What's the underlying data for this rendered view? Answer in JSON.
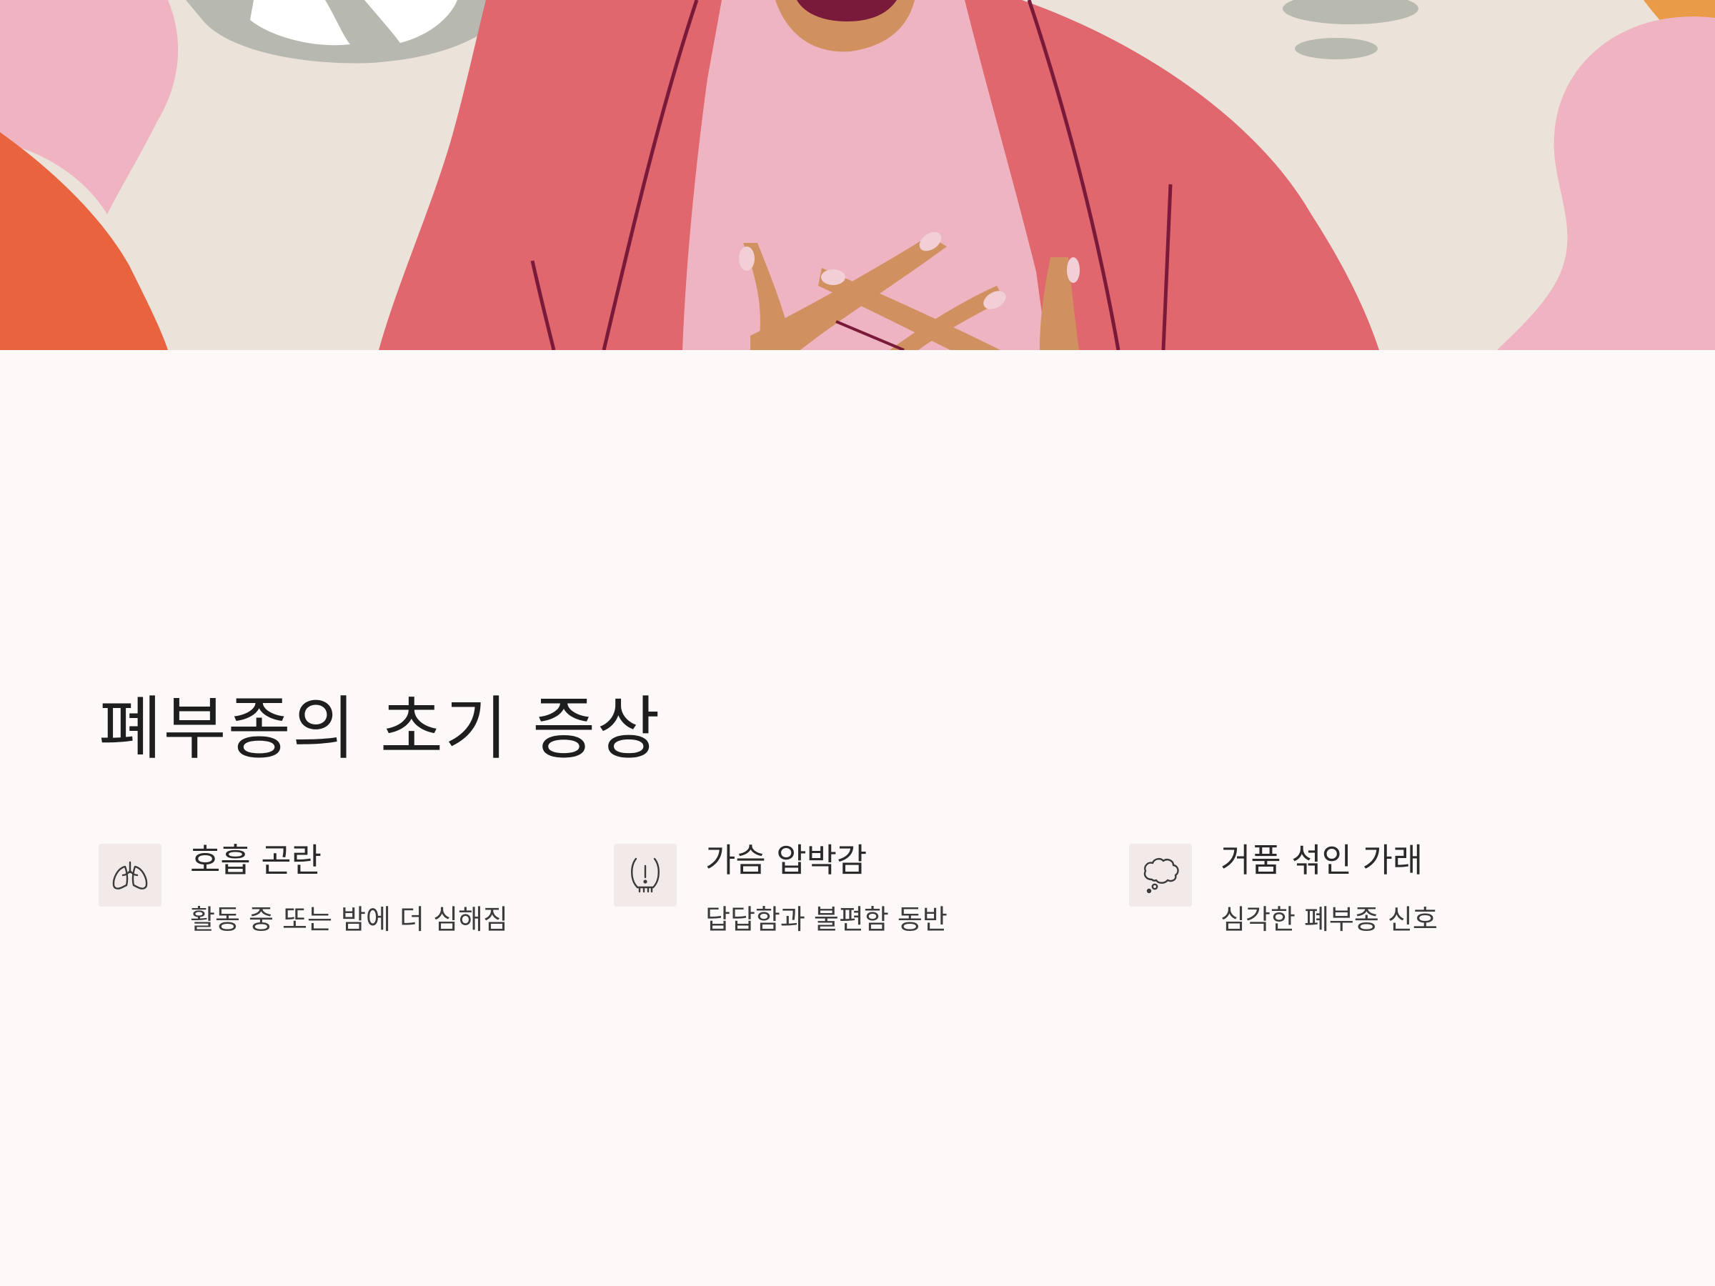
{
  "hero": {
    "image": "illustration-person-hands-crossed-on-chest"
  },
  "section": {
    "title": "폐부종의 초기 증상"
  },
  "symptoms": [
    {
      "icon": "lungs-icon",
      "title": "호흡 곤란",
      "desc": "활동 중 또는 밤에 더 심해짐"
    },
    {
      "icon": "chest-warning-icon",
      "title": "가슴 압박감",
      "desc": "답답함과 불편함 동반"
    },
    {
      "icon": "thought-cloud-icon",
      "title": "거품 섞인 가래",
      "desc": "심각한 폐부종 신호"
    }
  ],
  "colors": {
    "background": "#fdf9f8",
    "icon_bg": "#f1eae8",
    "title_text": "#1e1e1e",
    "jacket": "#df676d",
    "shirt": "#eeb4c2",
    "skin": "#d09060",
    "orange": "#e9633e",
    "pink_blob": "#efb3c1"
  }
}
